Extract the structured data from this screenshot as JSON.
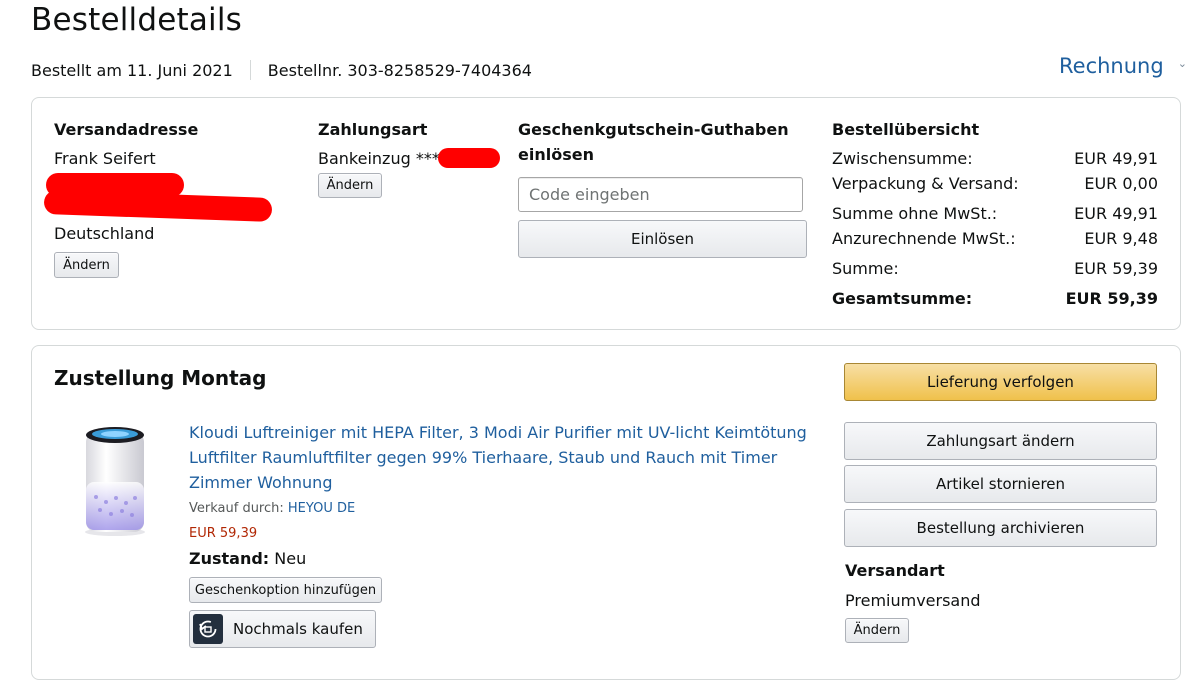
{
  "page": {
    "title": "Bestelldetails",
    "ordered_on": "Bestellt am 11. Juni 2021",
    "order_number": "Bestellnr. 303-8258529-7404364",
    "invoice_label": "Rechnung"
  },
  "shipping_address": {
    "heading": "Versandadresse",
    "name": "Frank Seifert",
    "country": "Deutschland",
    "change_label": "Ändern"
  },
  "payment": {
    "heading": "Zahlungsart",
    "method": "Bankeinzug ***",
    "change_label": "Ändern"
  },
  "gift_card": {
    "heading_line1": "Geschenkgutschein-Guthaben",
    "heading_line2": "einlösen",
    "placeholder": "Code eingeben",
    "redeem_label": "Einlösen"
  },
  "summary": {
    "heading": "Bestellübersicht",
    "rows": [
      {
        "label": "Zwischensumme:",
        "value": "EUR 49,91"
      },
      {
        "label": "Verpackung & Versand:",
        "value": "EUR 0,00"
      },
      {
        "label": "Summe ohne MwSt.:",
        "value": "EUR 49,91"
      },
      {
        "label": "Anzurechnende MwSt.:",
        "value": "EUR 9,48"
      },
      {
        "label": "Summe:",
        "value": "EUR 59,39"
      },
      {
        "label": "Gesamtsumme:",
        "value": "EUR 59,39"
      }
    ]
  },
  "shipment": {
    "heading": "Zustellung Montag",
    "product_title": "Kloudi Luftreiniger mit HEPA Filter, 3 Modi Air Purifier mit UV-licht Keimtötung Luftfilter Raumluftfilter gegen 99% Tierhaare, Staub und Rauch mit Timer Zimmer Wohnung",
    "seller_prefix": "Verkauf durch:",
    "seller_name": "HEYOU DE",
    "price": "EUR 59,39",
    "condition_label": "Zustand:",
    "condition_value": "Neu",
    "gift_option_label": "Geschenkoption hinzufügen",
    "buy_again_label": "Nochmals kaufen",
    "actions": {
      "track": "Lieferung verfolgen",
      "change_payment": "Zahlungsart ändern",
      "cancel": "Artikel stornieren",
      "archive": "Bestellung archivieren"
    },
    "shipping_method": {
      "heading": "Versandart",
      "value": "Premiumversand",
      "change_label": "Ändern"
    }
  },
  "colors": {
    "link": "#1f5f9e",
    "price": "#b12704",
    "primary_button": "#f0c14b",
    "redaction": "#ff0000"
  },
  "icons": {
    "invoice_dropdown": "chevron-down-icon",
    "buy_again": "reorder-icon"
  }
}
